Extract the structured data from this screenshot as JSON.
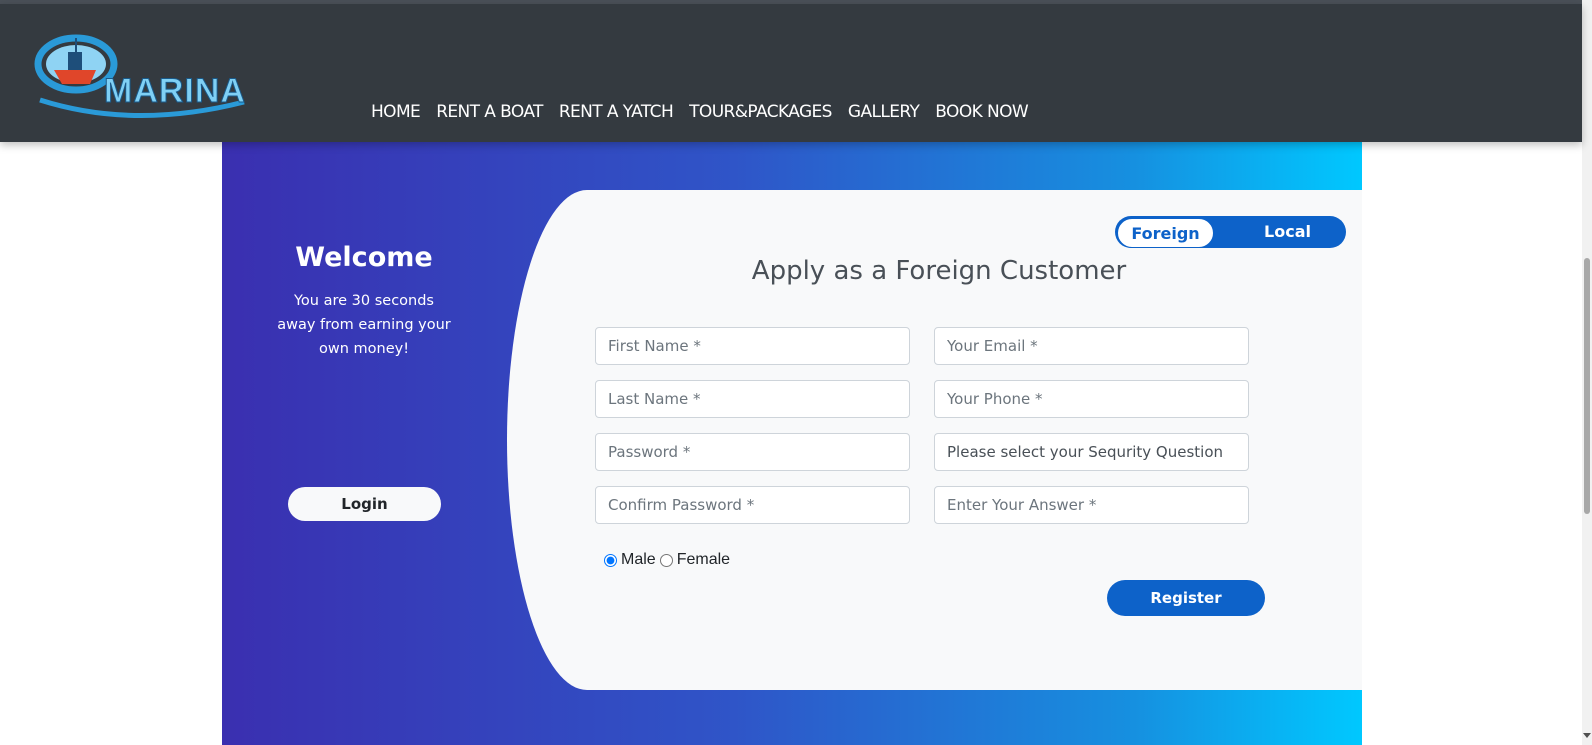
{
  "header": {
    "logo_text": "MARINA",
    "nav": [
      {
        "label": "HOME"
      },
      {
        "label": "RENT A BOAT"
      },
      {
        "label": "RENT A YATCH"
      },
      {
        "label": "TOUR&PACKAGES"
      },
      {
        "label": "GALLERY"
      },
      {
        "label": "BOOK NOW"
      }
    ]
  },
  "welcome": {
    "title": "Welcome",
    "subtitle": "You are 30 seconds away from earning your own money!",
    "login_label": "Login"
  },
  "toggle": {
    "foreign_label": "Foreign",
    "local_label": "Local",
    "selected": "Foreign"
  },
  "form": {
    "title": "Apply as a Foreign Customer",
    "first_name_placeholder": "First Name *",
    "last_name_placeholder": "Last Name *",
    "password_placeholder": "Password *",
    "confirm_password_placeholder": "Confirm Password *",
    "email_placeholder": "Your Email *",
    "phone_placeholder": "Your Phone *",
    "security_question_selected": "Please select your Sequrity Question",
    "answer_placeholder": "Enter Your Answer *",
    "gender_male": "Male",
    "gender_female": "Female",
    "gender_selected": "Male",
    "register_label": "Register"
  },
  "colors": {
    "navbar": "#343a40",
    "accent": "#0d62c9",
    "gradient_start": "#3a2fb0",
    "gradient_end": "#00c8ff"
  }
}
